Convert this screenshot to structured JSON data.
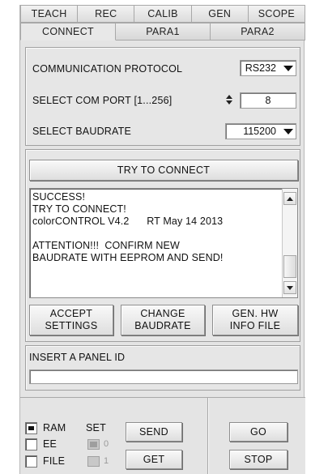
{
  "tabs_row1": [
    "TEACH",
    "REC",
    "CALIB",
    "GEN",
    "SCOPE"
  ],
  "tabs_row2": [
    "CONNECT",
    "PARA1",
    "PARA2"
  ],
  "active_tab": "CONNECT",
  "comm": {
    "protocol_label": "COMMUNICATION PROTOCOL",
    "protocol_value": "RS232",
    "port_label": "SELECT COM PORT [1...256]",
    "port_value": "8",
    "baud_label": "SELECT BAUDRATE",
    "baud_value": "115200"
  },
  "connect": {
    "try_button": "TRY TO CONNECT",
    "log_lines": [
      "SUCCESS!",
      "TRY TO CONNECT!",
      "colorCONTROL V4.2      RT May 14 2013",
      "",
      "ATTENTION!!!  CONFIRM NEW",
      "BAUDRATE WITH EEPROM AND SEND!"
    ],
    "accept_button": "ACCEPT\nSETTINGS",
    "change_button": "CHANGE\nBAUDRATE",
    "gen_button": "GEN. HW\nINFO FILE"
  },
  "panel_id": {
    "label": "INSERT A PANEL ID",
    "value": ""
  },
  "bottom": {
    "ram_label": "RAM",
    "ee_label": "EE",
    "file_label": "FILE",
    "set_label": "SET",
    "set0_label": "0",
    "set1_label": "1",
    "ram_checked": true,
    "ee_checked": false,
    "file_checked": false,
    "send_button": "SEND",
    "get_button": "GET",
    "go_button": "GO",
    "stop_button": "STOP"
  }
}
